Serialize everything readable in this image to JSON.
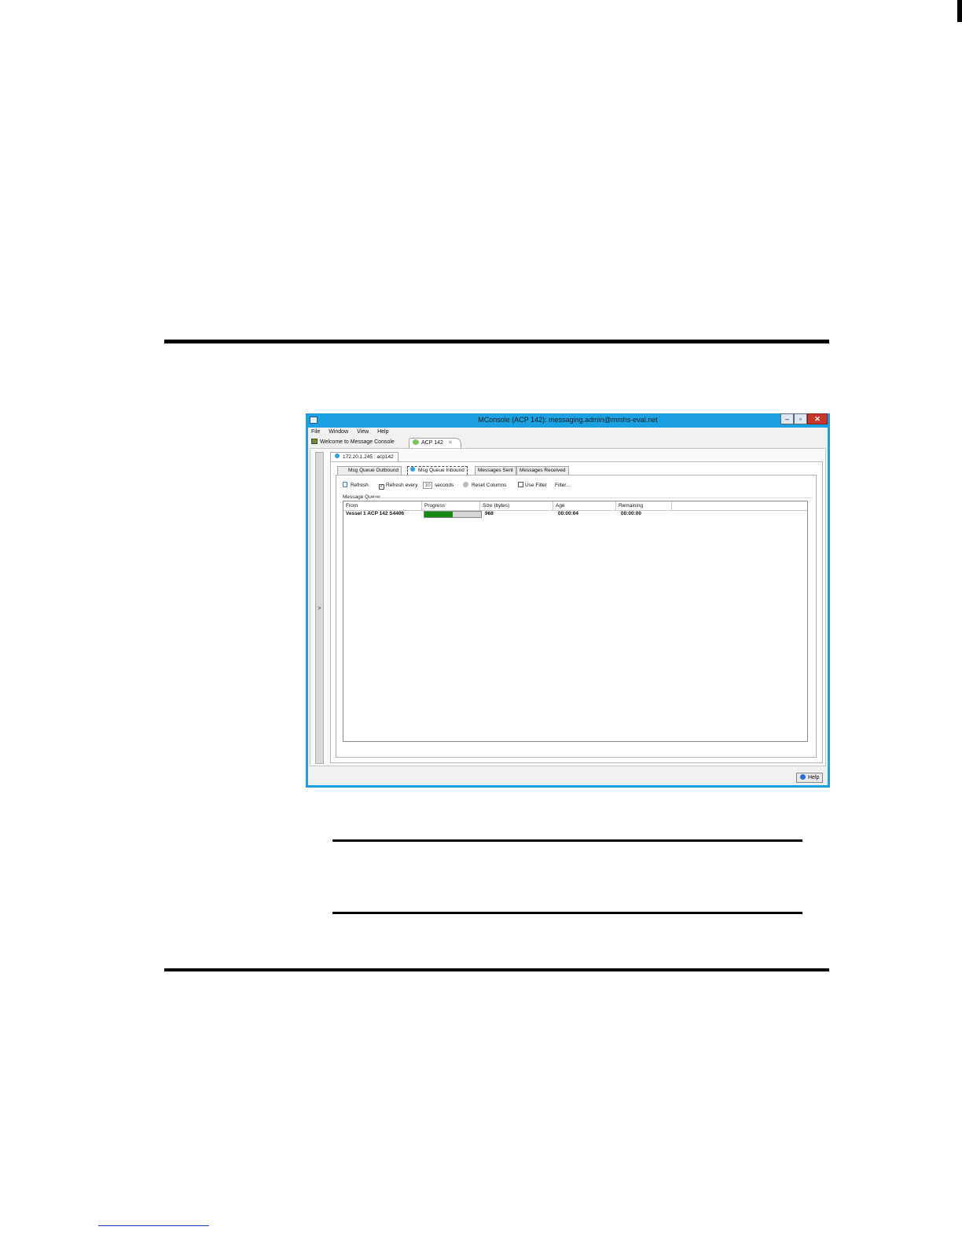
{
  "window": {
    "title": "MConsole (ACP 142): messaging.admin@mmhs-eval.net",
    "controls": {
      "minimize": "‒",
      "maximize": "▫",
      "close": "✕"
    }
  },
  "menu": [
    "File",
    "Window",
    "View",
    "Help"
  ],
  "editor_tabs": {
    "welcome": "Welcome to Message Console",
    "acp": "ACP 142",
    "acp_close": "✕"
  },
  "side_collapse": ">",
  "connection_tab": "172.20.1.245 : acp142",
  "queue_tabs": [
    "Msg Queue Outbound",
    "Msg Queue Inbound",
    "Messages Sent",
    "Messages Received"
  ],
  "toolbar": {
    "refresh": "Refresh",
    "refresh_every": "Refresh every",
    "refresh_every_checked": true,
    "interval": "10",
    "seconds": "seconds",
    "reset_columns": "Reset Columns",
    "use_filter": "Use Filter",
    "use_filter_checked": false,
    "filter": "Filter..."
  },
  "group_label": "Message Queue",
  "table": {
    "columns": [
      "From",
      "Progress",
      "Size (bytes)",
      "Age",
      "Remaining"
    ],
    "rows": [
      {
        "from": "Vessel 1 ACP 142 S4406",
        "progress": 0.5,
        "size": "968",
        "age": "00:00:04",
        "remaining": "00:00:00"
      }
    ]
  },
  "help_button": "Help",
  "colors": {
    "window_frame": "#1ba1e2",
    "progress_fill": "#138a13",
    "progress_track": "#d6d6d6"
  }
}
